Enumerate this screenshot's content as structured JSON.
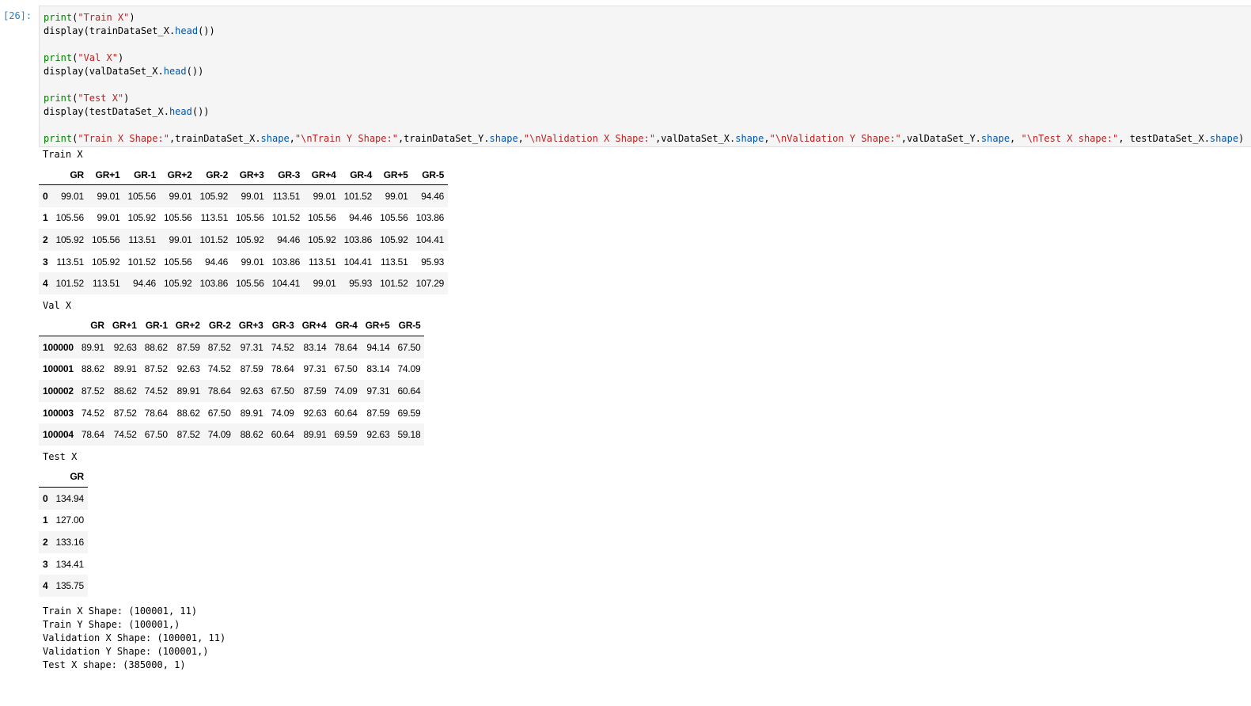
{
  "prompt": "[26]:",
  "code_lines": [
    [
      {
        "t": "print",
        "c": "k"
      },
      {
        "t": "(",
        "c": ""
      },
      {
        "t": "\"Train X\"",
        "c": "s"
      },
      {
        "t": ")",
        "c": ""
      }
    ],
    [
      {
        "t": "display(trainDataSet_X.",
        "c": ""
      },
      {
        "t": "head",
        "c": "a"
      },
      {
        "t": "())",
        "c": ""
      }
    ],
    [],
    [
      {
        "t": "print",
        "c": "k"
      },
      {
        "t": "(",
        "c": ""
      },
      {
        "t": "\"Val X\"",
        "c": "s"
      },
      {
        "t": ")",
        "c": ""
      }
    ],
    [
      {
        "t": "display(valDataSet_X.",
        "c": ""
      },
      {
        "t": "head",
        "c": "a"
      },
      {
        "t": "())",
        "c": ""
      }
    ],
    [],
    [
      {
        "t": "print",
        "c": "k"
      },
      {
        "t": "(",
        "c": ""
      },
      {
        "t": "\"Test X\"",
        "c": "s"
      },
      {
        "t": ")",
        "c": ""
      }
    ],
    [
      {
        "t": "display(testDataSet_X.",
        "c": ""
      },
      {
        "t": "head",
        "c": "a"
      },
      {
        "t": "())",
        "c": ""
      }
    ],
    [],
    [
      {
        "t": "print",
        "c": "k"
      },
      {
        "t": "(",
        "c": ""
      },
      {
        "t": "\"Train X Shape:\"",
        "c": "s"
      },
      {
        "t": ",trainDataSet_X.",
        "c": ""
      },
      {
        "t": "shape",
        "c": "a"
      },
      {
        "t": ",",
        "c": ""
      },
      {
        "t": "\"\\nTrain Y Shape:\"",
        "c": "s"
      },
      {
        "t": ",trainDataSet_Y.",
        "c": ""
      },
      {
        "t": "shape",
        "c": "a"
      },
      {
        "t": ",",
        "c": ""
      },
      {
        "t": "\"\\nValidation X Shape:\"",
        "c": "s"
      },
      {
        "t": ",valDataSet_X.",
        "c": ""
      },
      {
        "t": "shape",
        "c": "a"
      },
      {
        "t": ",",
        "c": ""
      },
      {
        "t": "\"\\nValidation Y Shape:\"",
        "c": "s"
      },
      {
        "t": ",valDataSet_Y.",
        "c": ""
      },
      {
        "t": "shape",
        "c": "a"
      },
      {
        "t": ", ",
        "c": ""
      },
      {
        "t": "\"\\nTest X shape:\"",
        "c": "s"
      },
      {
        "t": ", testDataSet_X.",
        "c": ""
      },
      {
        "t": "shape",
        "c": "a"
      },
      {
        "t": ")",
        "c": ""
      }
    ]
  ],
  "outputs": {
    "train": {
      "label": "Train X",
      "columns": [
        "",
        "GR",
        "GR+1",
        "GR-1",
        "GR+2",
        "GR-2",
        "GR+3",
        "GR-3",
        "GR+4",
        "GR-4",
        "GR+5",
        "GR-5"
      ],
      "rows": [
        [
          "0",
          "99.01",
          "99.01",
          "105.56",
          "99.01",
          "105.92",
          "99.01",
          "113.51",
          "99.01",
          "101.52",
          "99.01",
          "94.46"
        ],
        [
          "1",
          "105.56",
          "99.01",
          "105.92",
          "105.56",
          "113.51",
          "105.56",
          "101.52",
          "105.56",
          "94.46",
          "105.56",
          "103.86"
        ],
        [
          "2",
          "105.92",
          "105.56",
          "113.51",
          "99.01",
          "101.52",
          "105.92",
          "94.46",
          "105.92",
          "103.86",
          "105.92",
          "104.41"
        ],
        [
          "3",
          "113.51",
          "105.92",
          "101.52",
          "105.56",
          "94.46",
          "99.01",
          "103.86",
          "113.51",
          "104.41",
          "113.51",
          "95.93"
        ],
        [
          "4",
          "101.52",
          "113.51",
          "94.46",
          "105.92",
          "103.86",
          "105.56",
          "104.41",
          "99.01",
          "95.93",
          "101.52",
          "107.29"
        ]
      ]
    },
    "val": {
      "label": "Val X",
      "columns": [
        "",
        "GR",
        "GR+1",
        "GR-1",
        "GR+2",
        "GR-2",
        "GR+3",
        "GR-3",
        "GR+4",
        "GR-4",
        "GR+5",
        "GR-5"
      ],
      "rows": [
        [
          "100000",
          "89.91",
          "92.63",
          "88.62",
          "87.59",
          "87.52",
          "97.31",
          "74.52",
          "83.14",
          "78.64",
          "94.14",
          "67.50"
        ],
        [
          "100001",
          "88.62",
          "89.91",
          "87.52",
          "92.63",
          "74.52",
          "87.59",
          "78.64",
          "97.31",
          "67.50",
          "83.14",
          "74.09"
        ],
        [
          "100002",
          "87.52",
          "88.62",
          "74.52",
          "89.91",
          "78.64",
          "92.63",
          "67.50",
          "87.59",
          "74.09",
          "97.31",
          "60.64"
        ],
        [
          "100003",
          "74.52",
          "87.52",
          "78.64",
          "88.62",
          "67.50",
          "89.91",
          "74.09",
          "92.63",
          "60.64",
          "87.59",
          "69.59"
        ],
        [
          "100004",
          "78.64",
          "74.52",
          "67.50",
          "87.52",
          "74.09",
          "88.62",
          "60.64",
          "89.91",
          "69.59",
          "92.63",
          "59.18"
        ]
      ]
    },
    "test": {
      "label": "Test X",
      "columns": [
        "",
        "GR"
      ],
      "rows": [
        [
          "0",
          "134.94"
        ],
        [
          "1",
          "127.00"
        ],
        [
          "2",
          "133.16"
        ],
        [
          "3",
          "134.41"
        ],
        [
          "4",
          "135.75"
        ]
      ]
    },
    "shapes": [
      "Train X Shape: (100001, 11)",
      "Train Y Shape: (100001,)",
      "Validation X Shape: (100001, 11)",
      "Validation Y Shape: (100001,)",
      "Test X shape: (385000, 1)"
    ]
  }
}
